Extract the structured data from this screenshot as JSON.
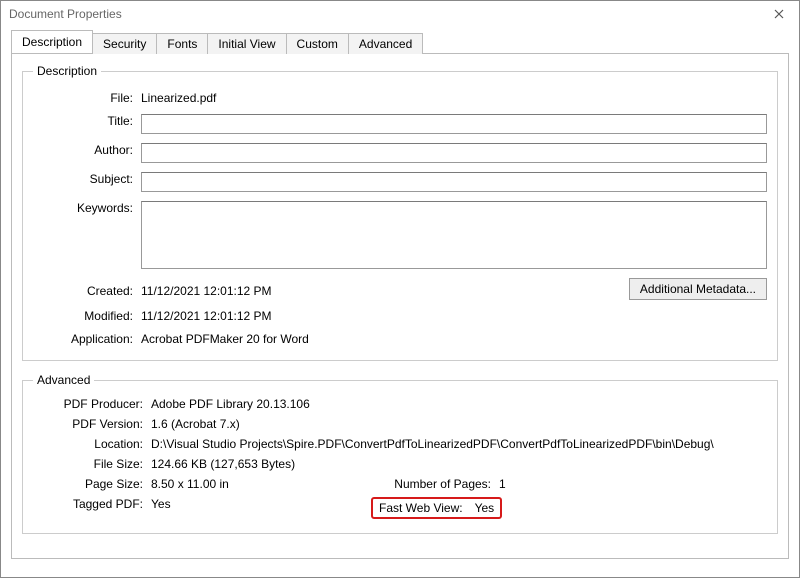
{
  "window": {
    "title": "Document Properties"
  },
  "tabs": [
    "Description",
    "Security",
    "Fonts",
    "Initial View",
    "Custom",
    "Advanced"
  ],
  "group1": {
    "legend": "Description"
  },
  "labels": {
    "file": "File:",
    "title": "Title:",
    "author": "Author:",
    "subject": "Subject:",
    "keywords": "Keywords:",
    "created": "Created:",
    "modified": "Modified:",
    "application": "Application:",
    "addl_meta": "Additional Metadata..."
  },
  "desc": {
    "file": "Linearized.pdf",
    "title": "",
    "author": "",
    "subject": "",
    "keywords": "",
    "created": "11/12/2021 12:01:12 PM",
    "modified": "11/12/2021 12:01:12 PM",
    "application": "Acrobat PDFMaker 20 for Word"
  },
  "group2": {
    "legend": "Advanced"
  },
  "adv_labels": {
    "producer": "PDF Producer:",
    "version": "PDF Version:",
    "location": "Location:",
    "filesize": "File Size:",
    "pagesize": "Page Size:",
    "numpages": "Number of Pages:",
    "tagged": "Tagged PDF:",
    "fastweb": "Fast Web View:"
  },
  "adv": {
    "producer": "Adobe PDF Library 20.13.106",
    "version": "1.6 (Acrobat 7.x)",
    "location": "D:\\Visual Studio Projects\\Spire.PDF\\ConvertPdfToLinearizedPDF\\ConvertPdfToLinearizedPDF\\bin\\Debug\\",
    "filesize": "124.66 KB (127,653 Bytes)",
    "pagesize": "8.50 x 11.00 in",
    "numpages": "1",
    "tagged": "Yes",
    "fastweb": "Yes"
  }
}
